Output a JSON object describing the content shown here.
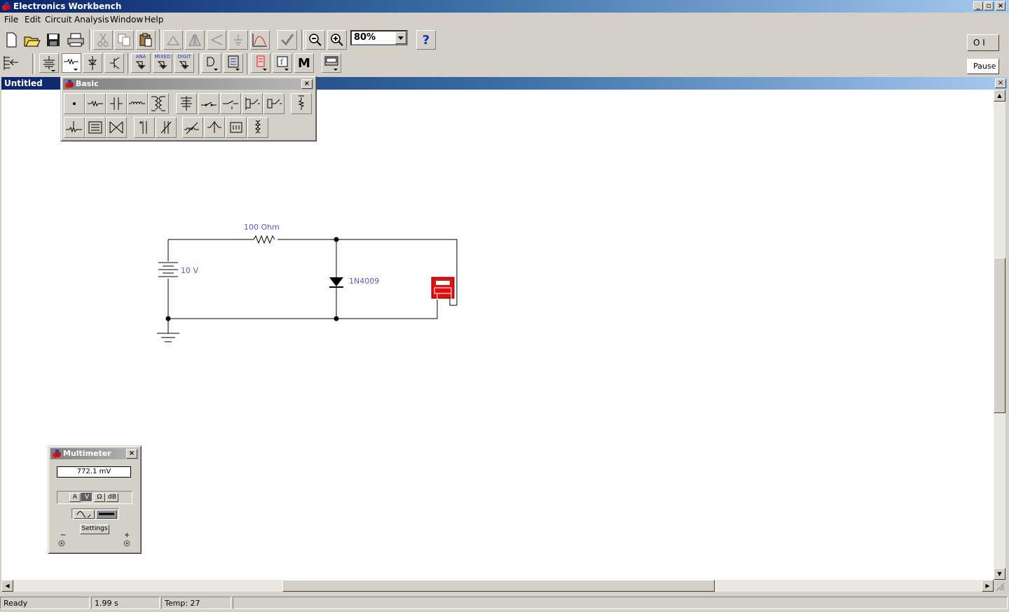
{
  "app": {
    "title": "Electronics Workbench"
  },
  "menu": [
    "File",
    "Edit",
    "Circuit",
    "Analysis",
    "Window",
    "Help"
  ],
  "toolbar": {
    "zoom_value": "80%",
    "help_label": "?",
    "pause_label": "Pause",
    "power_label": "O I"
  },
  "parts_bin": {
    "ana": "ANA",
    "mixed": "MIXED",
    "digit": "DIGIT",
    "misc_label": "M"
  },
  "document": {
    "title": "Untitled"
  },
  "basic_palette": {
    "title": "Basic"
  },
  "circuit": {
    "resistor_label": "100  Ohm",
    "battery_label": "10 V",
    "diode_label": "1N4009"
  },
  "multimeter": {
    "title": "Multimeter",
    "display": "772.1   mV",
    "modes": [
      "A",
      "V",
      "Ω",
      "dB"
    ],
    "selected_mode": "V",
    "settings_label": "Settings",
    "minus": "−",
    "plus": "+"
  },
  "status": {
    "state": "Ready",
    "time": "1.99 s",
    "temp": "Temp:  27"
  },
  "colors": {
    "accent": "#0a246a",
    "label_blue": "#5a5ad0",
    "meter_red": "#e01010"
  }
}
